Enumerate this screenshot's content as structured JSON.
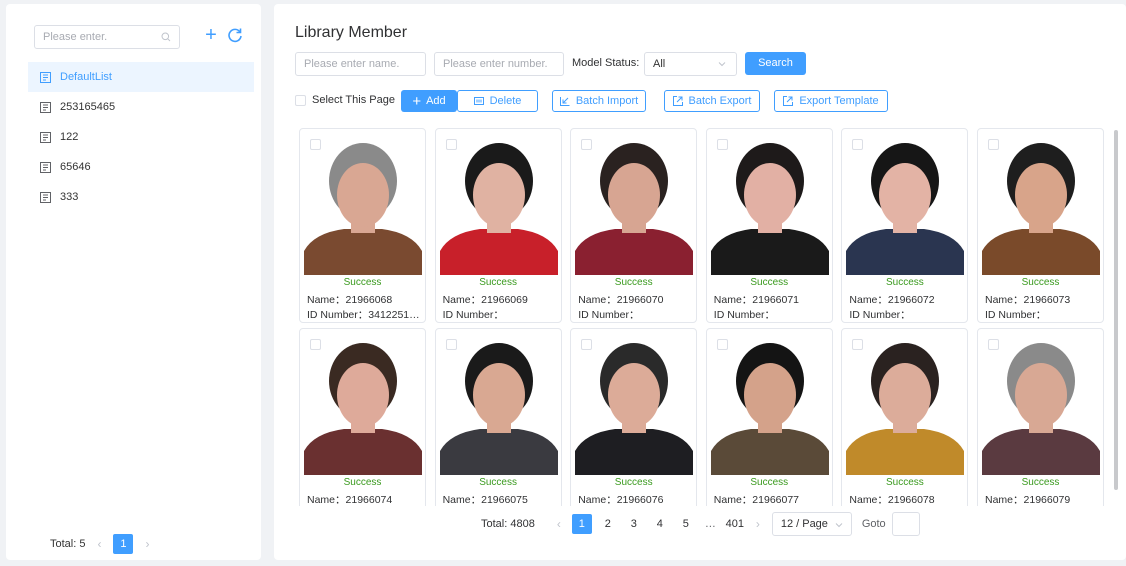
{
  "sidebar": {
    "search_placeholder": "Please enter.",
    "items": [
      {
        "label": "DefaultList",
        "active": true
      },
      {
        "label": "253165465"
      },
      {
        "label": "122"
      },
      {
        "label": "65646"
      },
      {
        "label": "333"
      }
    ],
    "pager": {
      "total": "Total: 5",
      "current": "1"
    }
  },
  "main": {
    "title": "Library Member",
    "filters": {
      "name_placeholder": "Please enter name.",
      "number_placeholder": "Please enter number.",
      "status_label": "Model Status:",
      "status_value": "All",
      "search_label": "Search"
    },
    "toolbar": {
      "select_page": "Select This Page",
      "add": "Add",
      "delete": "Delete",
      "batch_import": "Batch Import",
      "batch_export": "Batch Export",
      "export_template": "Export Template"
    },
    "members": [
      {
        "status": "Success",
        "name": "Name：21966068",
        "id": "ID Number：34122519…",
        "hair": "#8a8a8a",
        "shirt": "#7a4a30",
        "skin": "#d9a793"
      },
      {
        "status": "Success",
        "name": "Name：21966069",
        "id": "ID Number：",
        "hair": "#1a1a1a",
        "shirt": "#c8202a",
        "skin": "#e0b2a2"
      },
      {
        "status": "Success",
        "name": "Name：21966070",
        "id": "ID Number：",
        "hair": "#2a2220",
        "shirt": "#8a2030",
        "skin": "#d7a592"
      },
      {
        "status": "Success",
        "name": "Name：21966071",
        "id": "ID Number：",
        "hair": "#1e1a1a",
        "shirt": "#1a1a1a",
        "skin": "#e2b0a4"
      },
      {
        "status": "Success",
        "name": "Name：21966072",
        "id": "ID Number：",
        "hair": "#161616",
        "shirt": "#2a3550",
        "skin": "#e3b3a5"
      },
      {
        "status": "Success",
        "name": "Name：21966073",
        "id": "ID Number：",
        "hair": "#1e1e1e",
        "shirt": "#7a4a2a",
        "skin": "#d8a48a"
      },
      {
        "status": "Success",
        "name": "Name：21966074",
        "id": "",
        "hair": "#3a2a22",
        "shirt": "#6a3030",
        "skin": "#deaa9a"
      },
      {
        "status": "Success",
        "name": "Name：21966075",
        "id": "",
        "hair": "#1a1a1a",
        "shirt": "#3a3a40",
        "skin": "#d9a892"
      },
      {
        "status": "Success",
        "name": "Name：21966076",
        "id": "",
        "hair": "#2a2a2a",
        "shirt": "#1e1e22",
        "skin": "#dcab98"
      },
      {
        "status": "Success",
        "name": "Name：21966077",
        "id": "",
        "hair": "#141414",
        "shirt": "#5a4a38",
        "skin": "#d4a28a"
      },
      {
        "status": "Success",
        "name": "Name：21966078",
        "id": "",
        "hair": "#2a2220",
        "shirt": "#c08a2a",
        "skin": "#dcac9a"
      },
      {
        "status": "Success",
        "name": "Name：21966079",
        "id": "",
        "hair": "#8a8a8a",
        "shirt": "#5a3a40",
        "skin": "#d8a894"
      }
    ],
    "pager": {
      "total": "Total: 4808",
      "pages": [
        "1",
        "2",
        "3",
        "4",
        "5",
        "…",
        "401"
      ],
      "current": "1",
      "page_size": "12 / Page",
      "goto": "Goto"
    }
  },
  "colors": {
    "accent": "#409eff",
    "success": "#3a9a1e"
  }
}
